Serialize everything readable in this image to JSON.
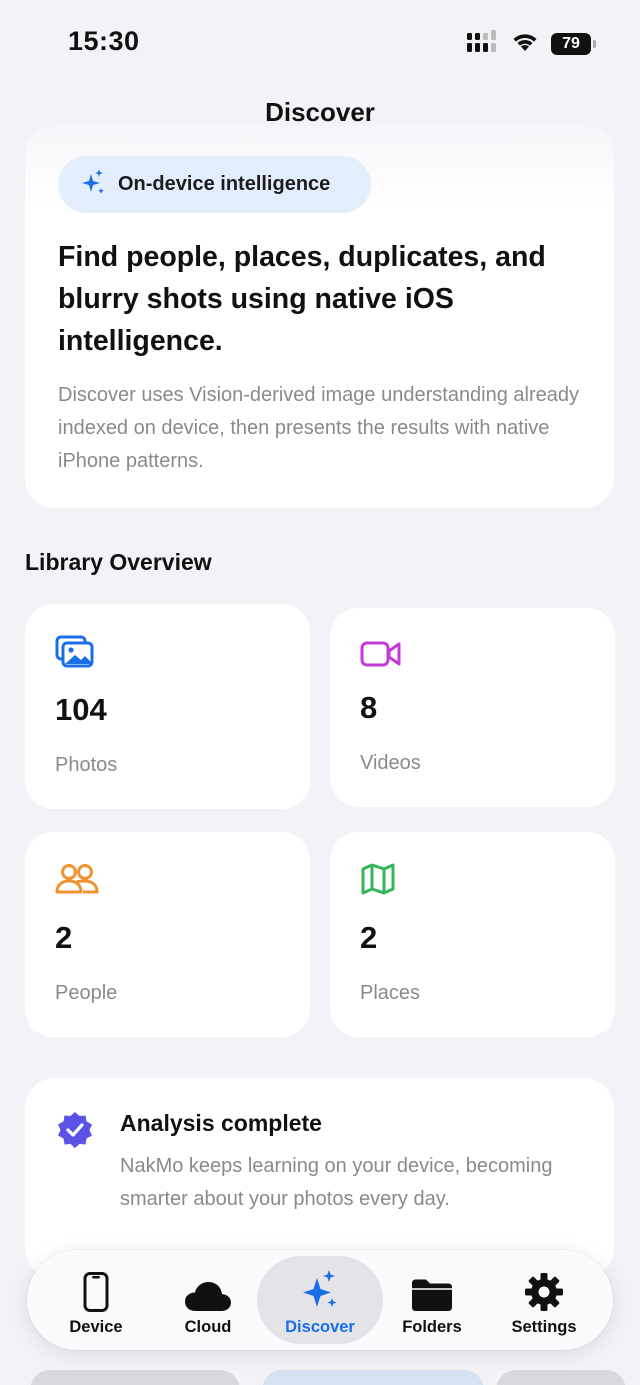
{
  "status_bar": {
    "time": "15:30",
    "battery": "79"
  },
  "nav": {
    "title": "Discover"
  },
  "hero": {
    "badge": "On-device intelligence",
    "title": "Find people, places, duplicates, and blurry shots using native iOS intelligence.",
    "description": "Discover uses Vision-derived image understanding already indexed on device, then presents the results with native iPhone patterns."
  },
  "overview": {
    "title": "Library Overview",
    "stats": [
      {
        "value": "104",
        "label": "Photos",
        "icon": "photos-icon",
        "color": "#1a6fe8"
      },
      {
        "value": "8",
        "label": "Videos",
        "icon": "video-camera-icon",
        "color": "#c43ad8"
      },
      {
        "value": "2",
        "label": "People",
        "icon": "people-icon",
        "color": "#f0922f"
      },
      {
        "value": "2",
        "label": "Places",
        "icon": "map-icon",
        "color": "#34b55a"
      }
    ]
  },
  "analysis": {
    "title": "Analysis complete",
    "description": "NakMo keeps learning on your device, becoming smarter about your photos every day.",
    "icon": "verified-badge-icon",
    "color": "#5b53e6"
  },
  "tabs": [
    {
      "label": "Device",
      "icon": "phone-icon",
      "active": false
    },
    {
      "label": "Cloud",
      "icon": "cloud-icon",
      "active": false
    },
    {
      "label": "Discover",
      "icon": "sparkles-icon",
      "active": true
    },
    {
      "label": "Folders",
      "icon": "folder-icon",
      "active": false
    },
    {
      "label": "Settings",
      "icon": "gear-icon",
      "active": false
    }
  ],
  "colors": {
    "accent": "#1a6fe8",
    "background": "#f2f2f7",
    "secondary_text": "#8a8a8e"
  }
}
